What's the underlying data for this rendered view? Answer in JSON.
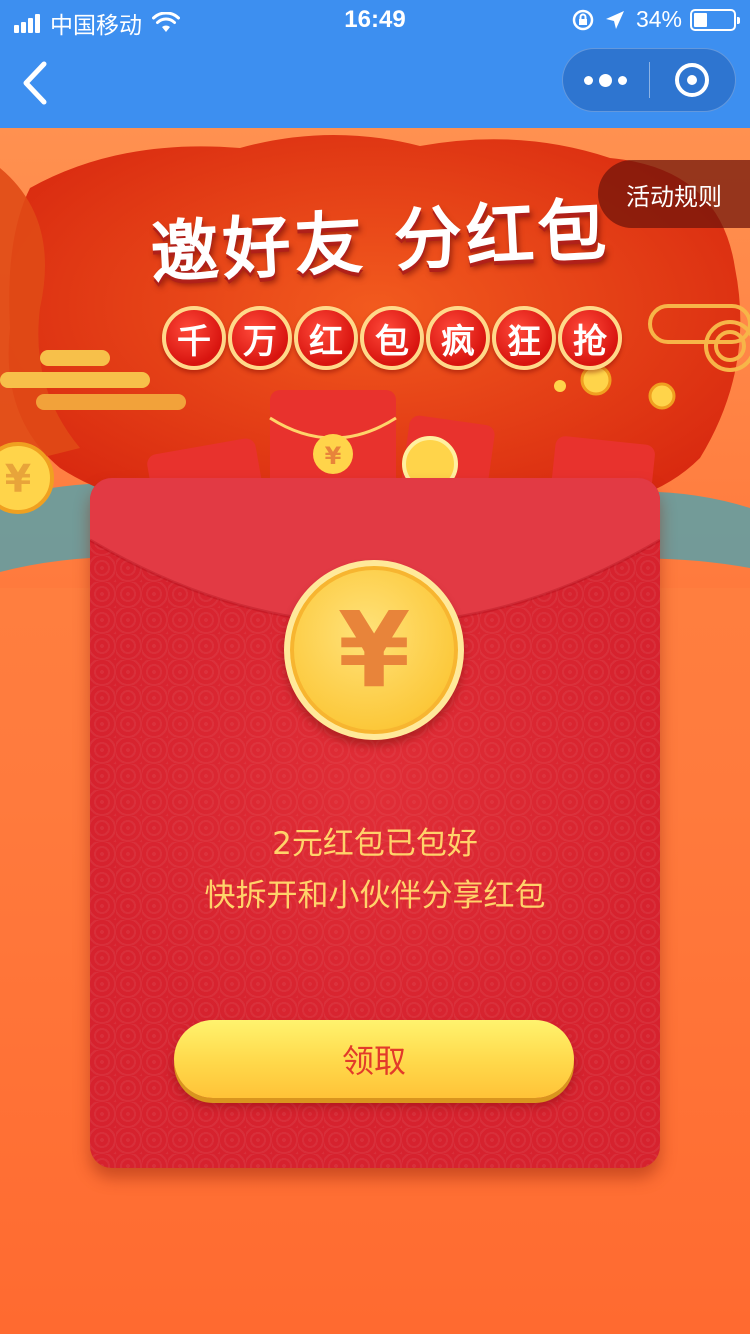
{
  "status_bar": {
    "carrier": "中国移动",
    "time": "16:49",
    "battery_percent": "34%",
    "battery_level": 0.34
  },
  "nav_bar": {
    "back_icon": "chevron-left-icon",
    "more_icon": "more-dots-icon",
    "close_icon": "target-circle-icon"
  },
  "banner": {
    "title": "邀好友 分红包",
    "subtitle_chars": [
      "千",
      "万",
      "红",
      "包",
      "疯",
      "狂",
      "抢"
    ],
    "rules_label": "活动规则"
  },
  "envelope": {
    "coin_symbol": "¥",
    "line1": "2元红包已包好",
    "line2": "快拆开和小伙伴分享红包",
    "claim_label": "领取"
  },
  "colors": {
    "nav_blue": "#3d8ff0",
    "envelope_red": "#d6222e",
    "text_gold": "#ffd36a",
    "button_yellow": "#ffd84a",
    "page_orange": "#ff7a3d"
  }
}
